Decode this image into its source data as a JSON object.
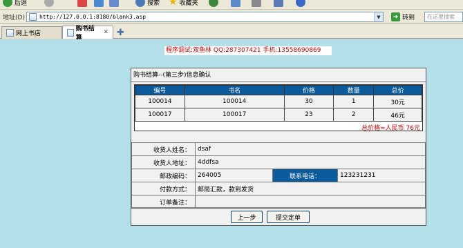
{
  "toolbar": {
    "back_label": "后退",
    "search_label": "搜索",
    "favorites_label": "收藏夹"
  },
  "address": {
    "label": "地址(D)",
    "url": "http://127.0.0.1:8180/blank3.asp",
    "go_label": "转到",
    "search_placeholder": "在这里搜索"
  },
  "tabs": [
    {
      "label": "网上书店",
      "active": false
    },
    {
      "label": "购书结算",
      "active": true
    }
  ],
  "contact_line": "程序调试:双鱼林 QQ:287307421 手机:13558690869",
  "checkout": {
    "title": "购书结算--(第三步)信息确认",
    "columns": [
      "编号",
      "书名",
      "价格",
      "数量",
      "总价"
    ],
    "rows": [
      [
        "100014",
        "100014",
        "30",
        "1",
        "30元"
      ],
      [
        "100017",
        "100017",
        "23",
        "2",
        "46元"
      ]
    ],
    "total_text": "总价格=人民币 76元"
  },
  "form": {
    "name_label": "收货人姓名：",
    "name_value": "dsaf",
    "address_label": "收货人地址：",
    "address_value": "4ddfsa",
    "postcode_label": "邮政编码：",
    "postcode_value": "264005",
    "phone_label": "联系电话：",
    "phone_value": "123231231",
    "payment_label": "付款方式：",
    "payment_value": "邮局汇款，款到发货",
    "note_label": "订单备注：",
    "note_value": ""
  },
  "buttons": {
    "prev_label": "上一步",
    "submit_label": "提交定单"
  },
  "colors": {
    "page_bg": "#b3dfe9",
    "header_blue": "#0a5a9c",
    "alert_red": "#cc0000"
  }
}
